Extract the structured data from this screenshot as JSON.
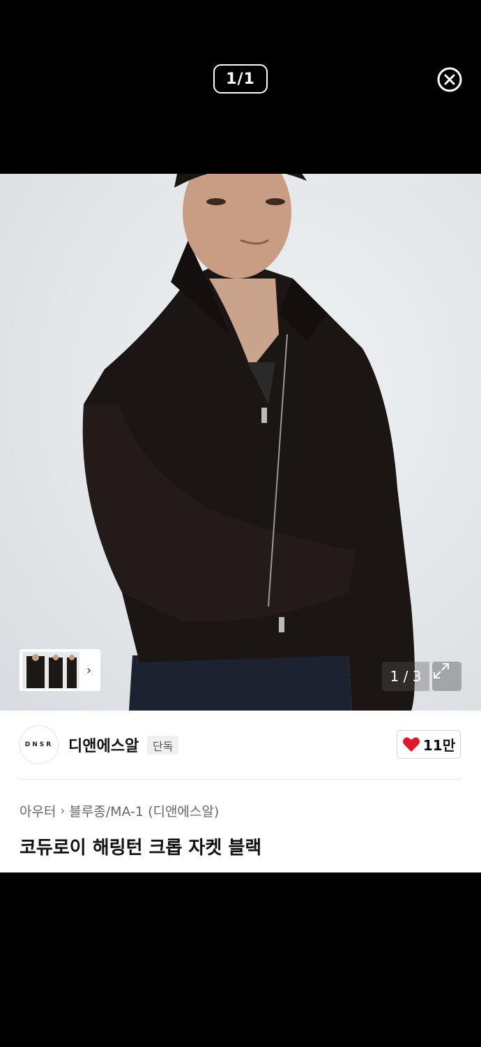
{
  "viewer": {
    "counter": "1/1",
    "close_icon": "close-circle-icon"
  },
  "gallery": {
    "photo_counter": "1 / 3",
    "thumbnail_chevron": "›",
    "expand_icon": "expand-arrows-icon"
  },
  "brand": {
    "logo_text": "DNSR",
    "name": "디앤에스알",
    "badge": "단독"
  },
  "like": {
    "icon": "heart-icon",
    "count": "11만",
    "color": "#e0192a"
  },
  "breadcrumb": {
    "category": "아우터",
    "separator": "›",
    "subcategory": "블루종/MA-1 (디앤에스알)"
  },
  "product": {
    "title": "코듀로이 해링턴 크롭 자켓 블랙"
  }
}
